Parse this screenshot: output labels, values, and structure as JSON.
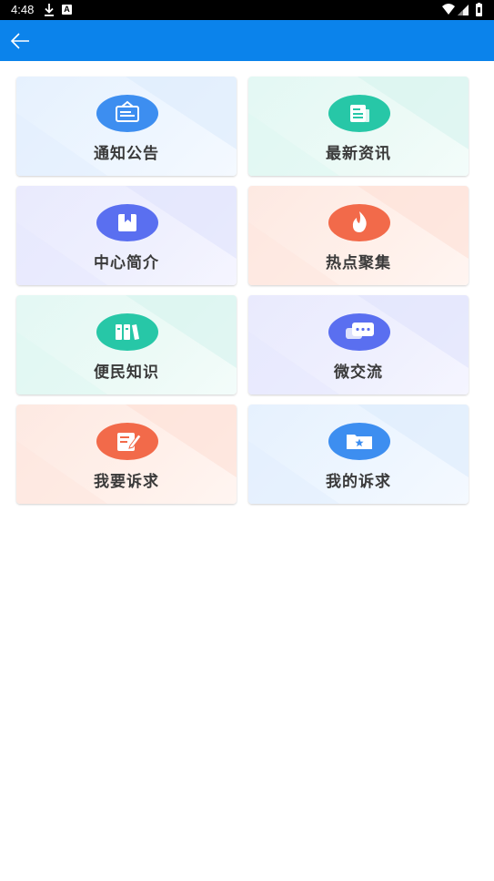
{
  "status_bar": {
    "time": "4:48",
    "notif_a": "A"
  },
  "app_bar": {
    "back_icon": "arrow-left-icon"
  },
  "colors": {
    "app_bar": "#0b83eb",
    "blue": "#3d8ef0",
    "teal": "#27c7a7",
    "purple": "#5a6ff0",
    "orange": "#f26a4a"
  },
  "menu": [
    {
      "label": "通知公告",
      "icon": "notice-board-icon",
      "theme": "blue"
    },
    {
      "label": "最新资讯",
      "icon": "newspaper-icon",
      "theme": "teal"
    },
    {
      "label": "中心简介",
      "icon": "book-icon",
      "theme": "purple"
    },
    {
      "label": "热点聚集",
      "icon": "fire-icon",
      "theme": "orange"
    },
    {
      "label": "便民知识",
      "icon": "books-icon",
      "theme": "teal"
    },
    {
      "label": "微交流",
      "icon": "chat-icon",
      "theme": "purple"
    },
    {
      "label": "我要诉求",
      "icon": "edit-note-icon",
      "theme": "orange"
    },
    {
      "label": "我的诉求",
      "icon": "folder-star-icon",
      "theme": "blue"
    }
  ]
}
